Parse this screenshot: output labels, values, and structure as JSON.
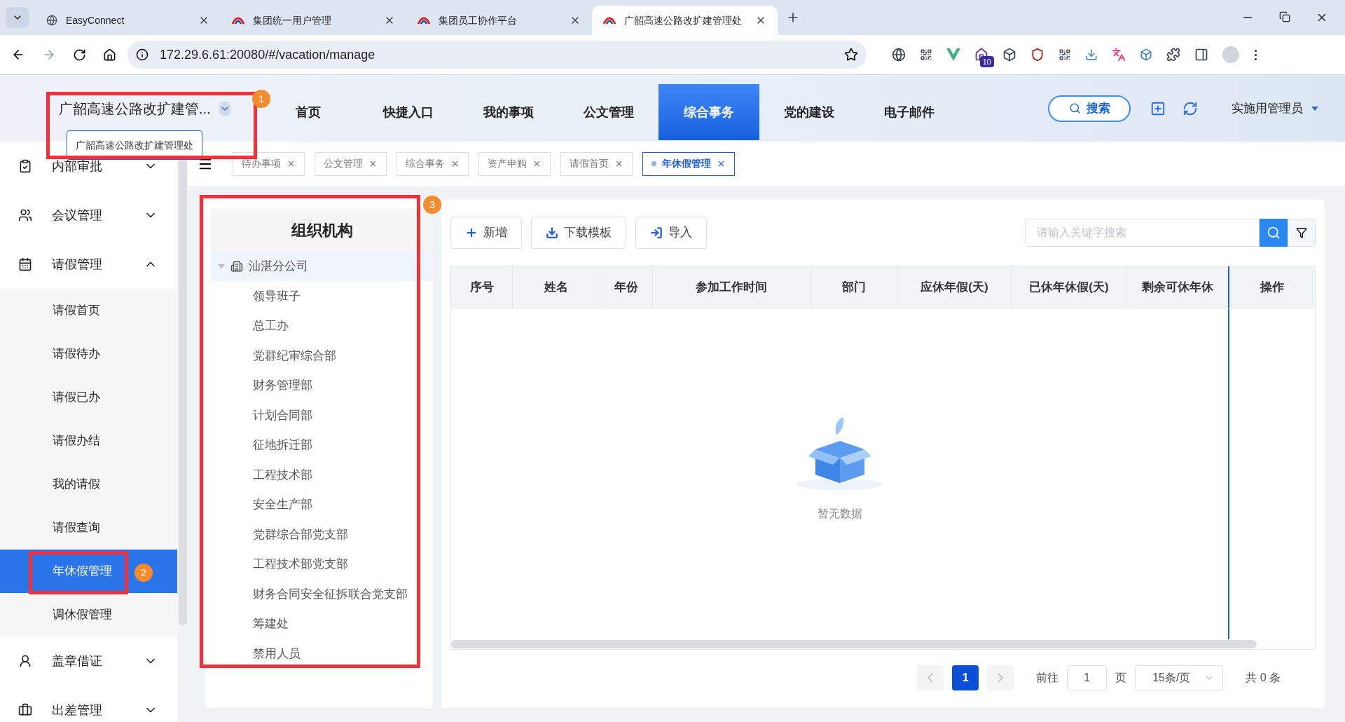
{
  "browser": {
    "tabs": [
      {
        "title": "EasyConnect",
        "selected": false
      },
      {
        "title": "集团统一用户管理",
        "selected": false
      },
      {
        "title": "集团员工协作平台",
        "selected": false
      },
      {
        "title": "广韶高速公路改扩建管理处",
        "selected": true
      }
    ],
    "url": "172.29.6.61:20080/#/vacation/manage",
    "extension_badge": "10"
  },
  "header": {
    "org": "广韶高速公路改扩建管...",
    "org_tooltip": "广韶高速公路改扩建管理处",
    "nav": [
      {
        "label": "首页",
        "selected": false
      },
      {
        "label": "快捷入口",
        "selected": false
      },
      {
        "label": "我的事项",
        "selected": false
      },
      {
        "label": "公文管理",
        "selected": false
      },
      {
        "label": "综合事务",
        "selected": true
      },
      {
        "label": "党的建设",
        "selected": false
      },
      {
        "label": "电子邮件",
        "selected": false
      }
    ],
    "search_button": "搜索",
    "user": "实施用管理员"
  },
  "sidebar": {
    "items": [
      {
        "label": "内部审批",
        "expanded": false
      },
      {
        "label": "会议管理",
        "expanded": false
      },
      {
        "label": "请假管理",
        "expanded": true,
        "children": [
          {
            "label": "请假首页",
            "selected": false
          },
          {
            "label": "请假待办",
            "selected": false
          },
          {
            "label": "请假已办",
            "selected": false
          },
          {
            "label": "请假办结",
            "selected": false
          },
          {
            "label": "我的请假",
            "selected": false
          },
          {
            "label": "请假查询",
            "selected": false
          },
          {
            "label": "年休假管理",
            "selected": true
          },
          {
            "label": "调休假管理",
            "selected": false
          }
        ]
      },
      {
        "label": "盖章借证",
        "expanded": false
      },
      {
        "label": "出差管理",
        "expanded": false
      }
    ]
  },
  "open_tabs": [
    {
      "label": "待办事项",
      "selected": false
    },
    {
      "label": "公文管理",
      "selected": false
    },
    {
      "label": "综合事务",
      "selected": false
    },
    {
      "label": "资产申购",
      "selected": false
    },
    {
      "label": "请假首页",
      "selected": false
    },
    {
      "label": "年休假管理",
      "selected": true
    }
  ],
  "org_tree": {
    "title": "组织机构",
    "root": {
      "label": "汕湛分公司",
      "expanded": true,
      "children": [
        {
          "label": "领导班子"
        },
        {
          "label": "总工办"
        },
        {
          "label": "党群纪审综合部"
        },
        {
          "label": "财务管理部"
        },
        {
          "label": "计划合同部"
        },
        {
          "label": "征地拆迁部"
        },
        {
          "label": "工程技术部"
        },
        {
          "label": "安全生产部"
        },
        {
          "label": "党群综合部党支部"
        },
        {
          "label": "工程技术部党支部"
        },
        {
          "label": "财务合同安全征拆联合党支部"
        },
        {
          "label": "筹建处"
        },
        {
          "label": "禁用人员"
        }
      ]
    }
  },
  "toolbar": {
    "buttons": [
      {
        "label": "新增",
        "kind": "add"
      },
      {
        "label": "下载模板",
        "kind": "download"
      },
      {
        "label": "导入",
        "kind": "import"
      }
    ],
    "search": {
      "placeholder": "请输入关键字搜索"
    }
  },
  "table": {
    "columns": [
      "序号",
      "姓名",
      "年份",
      "参加工作时间",
      "部门",
      "应休年假(天)",
      "已休年休假(天)",
      "剩余可休年休"
    ],
    "fixed_column": "操作",
    "empty_text": "暂无数据"
  },
  "pagination": {
    "pages": [
      {
        "label": "1",
        "selected": true
      }
    ],
    "goto_label": "前往",
    "goto_value": "1",
    "page_unit": "页",
    "page_size": "15条/页",
    "total": "共 0 条"
  },
  "annotations": [
    "1",
    "2",
    "3"
  ]
}
